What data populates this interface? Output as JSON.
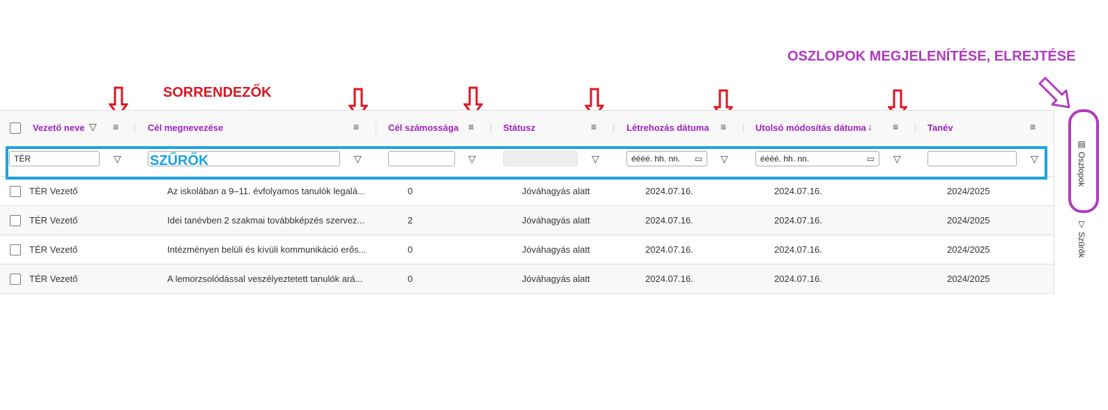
{
  "annotations": {
    "sorters_label": "SORRENDEZŐK",
    "filters_label": "SZŰRŐK",
    "columns_label": "OSZLOPOK MEGJELENÍTÉSE, ELREJTÉSE",
    "red_color": "#e0141f",
    "blue_color": "#1aa3e3",
    "purple_color": "#b03bbe"
  },
  "columns": [
    {
      "label": "Vezető neve",
      "filter_value": "TÉR"
    },
    {
      "label": "Cél megnevezése",
      "filter_value": ""
    },
    {
      "label": "Cél számossága",
      "filter_value": ""
    },
    {
      "label": "Státusz",
      "filter_value": ""
    },
    {
      "label": "Létrehozás dátuma",
      "filter_placeholder": "éééé. hh. nn."
    },
    {
      "label": "Utolsó módosítás dátuma",
      "filter_placeholder": "éééé. hh. nn.",
      "sort": "desc"
    },
    {
      "label": "Tanév",
      "filter_value": ""
    }
  ],
  "rows": [
    [
      "TÉR Vezető",
      "Az iskolában a 9–11. évfolyamos tanulók legalá...",
      "0",
      "Jóváhagyás alatt",
      "2024.07.16.",
      "2024.07.16.",
      "2024/2025"
    ],
    [
      "TÉR Vezető",
      "Idei tanévben 2 szakmai továbbképzés szervez...",
      "2",
      "Jóváhagyás alatt",
      "2024.07.16.",
      "2024.07.16.",
      "2024/2025"
    ],
    [
      "TÉR Vezető",
      "Intézményen belüli és kívüli kommunikáció erős...",
      "0",
      "Jóváhagyás alatt",
      "2024.07.16.",
      "2024.07.16.",
      "2024/2025"
    ],
    [
      "TÉR Vezető",
      "A lemorzsolódással veszélyeztetett tanulók ará...",
      "0",
      "Jóváhagyás alatt",
      "2024.07.16.",
      "2024.07.16.",
      "2024/2025"
    ]
  ],
  "sidebar": {
    "columns_tab": "Oszlopok",
    "filters_tab": "Szűrők"
  },
  "icons": {
    "menu": "menu-icon",
    "filter": "funnel-icon",
    "sort_desc": "arrow-down-icon",
    "calendar": "calendar-icon",
    "columns": "columns-icon"
  },
  "colors": {
    "header_text": "#a020c0",
    "header_bg": "#f8f8f8"
  }
}
